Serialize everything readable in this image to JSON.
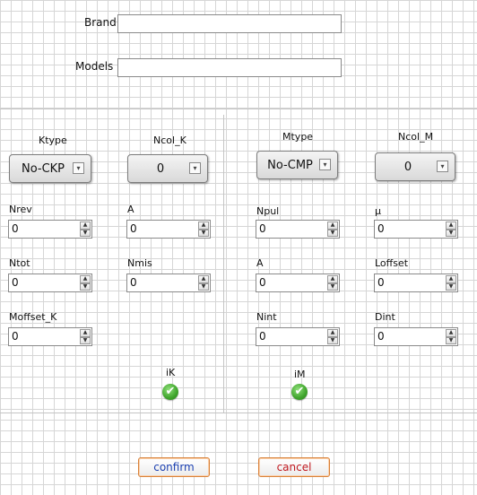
{
  "brand": {
    "label": "Brand",
    "value": ""
  },
  "models": {
    "label": "Models",
    "value": ""
  },
  "ktype": {
    "label": "Ktype",
    "value": "No-CKP"
  },
  "ncol_k": {
    "label": "Ncol_K",
    "value": "0"
  },
  "mtype": {
    "label": "Mtype",
    "value": "No-CMP"
  },
  "ncol_m": {
    "label": "Ncol_M",
    "value": "0"
  },
  "left_fields": {
    "nrev": {
      "label": "Nrev",
      "value": "0"
    },
    "a": {
      "label": "A",
      "value": "0"
    },
    "ntot": {
      "label": "Ntot",
      "value": "0"
    },
    "nmis": {
      "label": "Nmis",
      "value": "0"
    },
    "moffset_k": {
      "label": "Moffset_K",
      "value": "0"
    }
  },
  "right_fields": {
    "npul": {
      "label": "Npul",
      "value": "0"
    },
    "mu": {
      "label": "μ",
      "value": "0"
    },
    "a": {
      "label": "A",
      "value": "0"
    },
    "loffset": {
      "label": "Loffset",
      "value": "0"
    },
    "nint": {
      "label": "Nint",
      "value": "0"
    },
    "dint": {
      "label": "Dint",
      "value": "0"
    }
  },
  "indicators": {
    "ik": {
      "label": "iK",
      "icon": "checkmark-icon",
      "color": "#3ea32b"
    },
    "im": {
      "label": "iM",
      "icon": "checkmark-icon",
      "color": "#3ea32b"
    }
  },
  "buttons": {
    "confirm": {
      "label": "confirm",
      "color": "#1a3fb0"
    },
    "cancel": {
      "label": "cancel",
      "color": "#c0181f"
    }
  },
  "icons": {
    "dropdown": "▾",
    "spin_up": "▲",
    "spin_down": "▼",
    "check": "✔"
  }
}
